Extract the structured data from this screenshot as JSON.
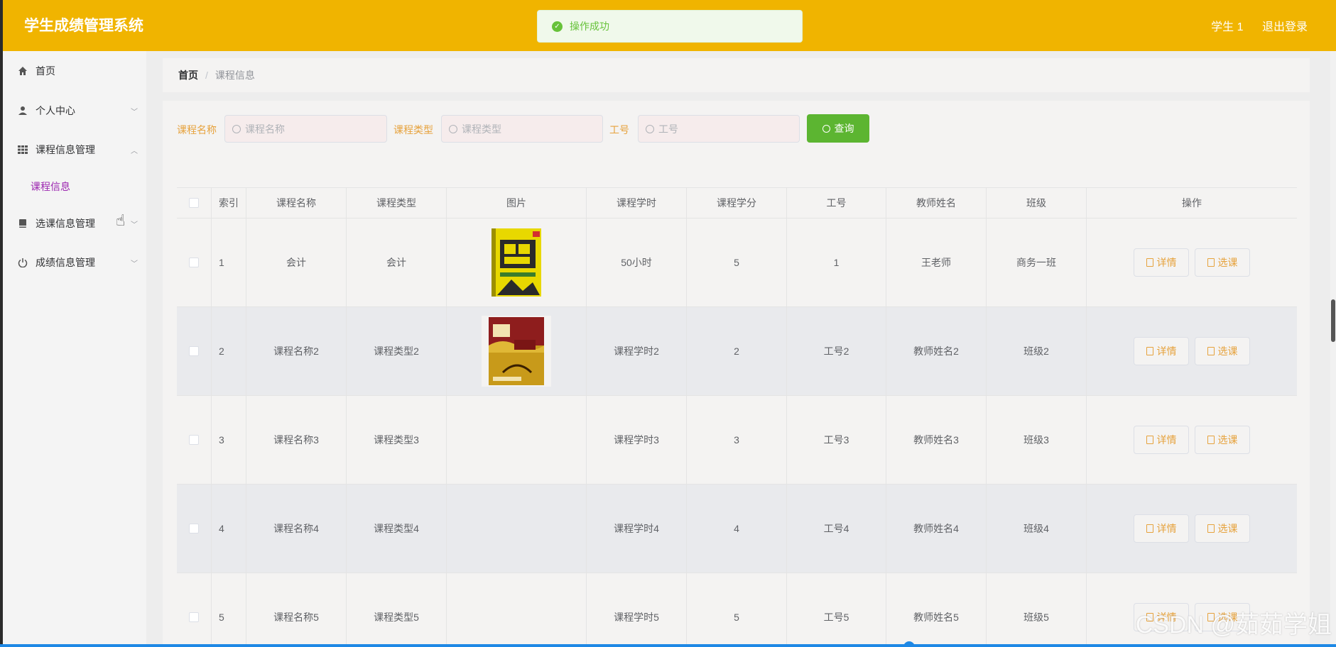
{
  "header": {
    "app_title": "学生成绩管理系统",
    "user_name": "学生 1",
    "logout_label": "退出登录",
    "toast_message": "操作成功"
  },
  "sidebar": {
    "items": [
      {
        "label": "首页",
        "icon": "home-icon"
      },
      {
        "label": "个人中心",
        "icon": "user-icon",
        "expanded": false
      },
      {
        "label": "课程信息管理",
        "icon": "grid-icon",
        "expanded": true
      },
      {
        "label": "选课信息管理",
        "icon": "book-icon",
        "expanded": false
      },
      {
        "label": "成绩信息管理",
        "icon": "power-icon",
        "expanded": false
      }
    ],
    "sub_item": "课程信息"
  },
  "breadcrumb": {
    "home": "首页",
    "separator": "/",
    "current": "课程信息"
  },
  "search": {
    "course_name_label": "课程名称",
    "course_name_placeholder": "课程名称",
    "course_type_label": "课程类型",
    "course_type_placeholder": "课程类型",
    "staff_no_label": "工号",
    "staff_no_placeholder": "工号",
    "query_label": "查询"
  },
  "table": {
    "headers": [
      "索引",
      "课程名称",
      "课程类型",
      "图片",
      "课程学时",
      "课程学分",
      "工号",
      "教师姓名",
      "班级",
      "操作"
    ],
    "detail_label": "详情",
    "select_label": "选课",
    "rows": [
      {
        "index": "1",
        "name": "会计",
        "type": "会计",
        "image": "book-cover-sales",
        "hours": "50小时",
        "credits": "5",
        "staff_no": "1",
        "teacher": "王老师",
        "class": "商务一班"
      },
      {
        "index": "2",
        "name": "课程名称2",
        "type": "课程类型2",
        "image": "book-cover-health",
        "hours": "课程学时2",
        "credits": "2",
        "staff_no": "工号2",
        "teacher": "教师姓名2",
        "class": "班级2"
      },
      {
        "index": "3",
        "name": "课程名称3",
        "type": "课程类型3",
        "image": "",
        "hours": "课程学时3",
        "credits": "3",
        "staff_no": "工号3",
        "teacher": "教师姓名3",
        "class": "班级3"
      },
      {
        "index": "4",
        "name": "课程名称4",
        "type": "课程类型4",
        "image": "",
        "hours": "课程学时4",
        "credits": "4",
        "staff_no": "工号4",
        "teacher": "教师姓名4",
        "class": "班级4"
      },
      {
        "index": "5",
        "name": "课程名称5",
        "type": "课程类型5",
        "image": "",
        "hours": "课程学时5",
        "credits": "5",
        "staff_no": "工号5",
        "teacher": "教师姓名5",
        "class": "班级5"
      }
    ]
  },
  "watermark": "CSDN @茹茹学姐",
  "colors": {
    "header": "#f0b400",
    "accent": "#e6a23c",
    "query_button": "#5cb531",
    "active_submenu": "#9c27b0"
  }
}
